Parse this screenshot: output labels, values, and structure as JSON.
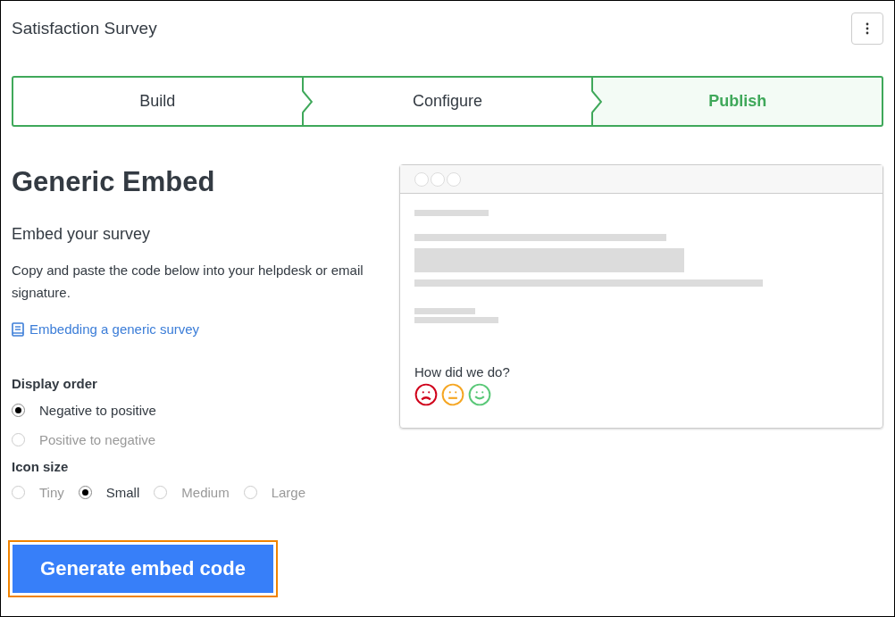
{
  "header": {
    "title": "Satisfaction Survey"
  },
  "steps": [
    {
      "label": "Build",
      "selected": false
    },
    {
      "label": "Configure",
      "selected": false
    },
    {
      "label": "Publish",
      "selected": true
    }
  ],
  "heading": "Generic Embed",
  "subheading": "Embed your survey",
  "description": "Copy and paste the code below into your helpdesk or email signature.",
  "help_link": "Embedding a generic survey",
  "display_order": {
    "label": "Display order",
    "options": [
      {
        "label": "Negative to positive",
        "selected": true
      },
      {
        "label": "Positive to negative",
        "selected": false
      }
    ]
  },
  "icon_size": {
    "label": "Icon size",
    "options": [
      {
        "label": "Tiny",
        "selected": false
      },
      {
        "label": "Small",
        "selected": true
      },
      {
        "label": "Medium",
        "selected": false
      },
      {
        "label": "Large",
        "selected": false
      }
    ]
  },
  "preview": {
    "question": "How did we do?",
    "faces": [
      {
        "kind": "sad",
        "color": "#d0021b"
      },
      {
        "kind": "neutral",
        "color": "#f5a623"
      },
      {
        "kind": "happy",
        "color": "#5ac878"
      }
    ]
  },
  "generate_button": {
    "label": "Generate embed code",
    "highlighted": true
  }
}
